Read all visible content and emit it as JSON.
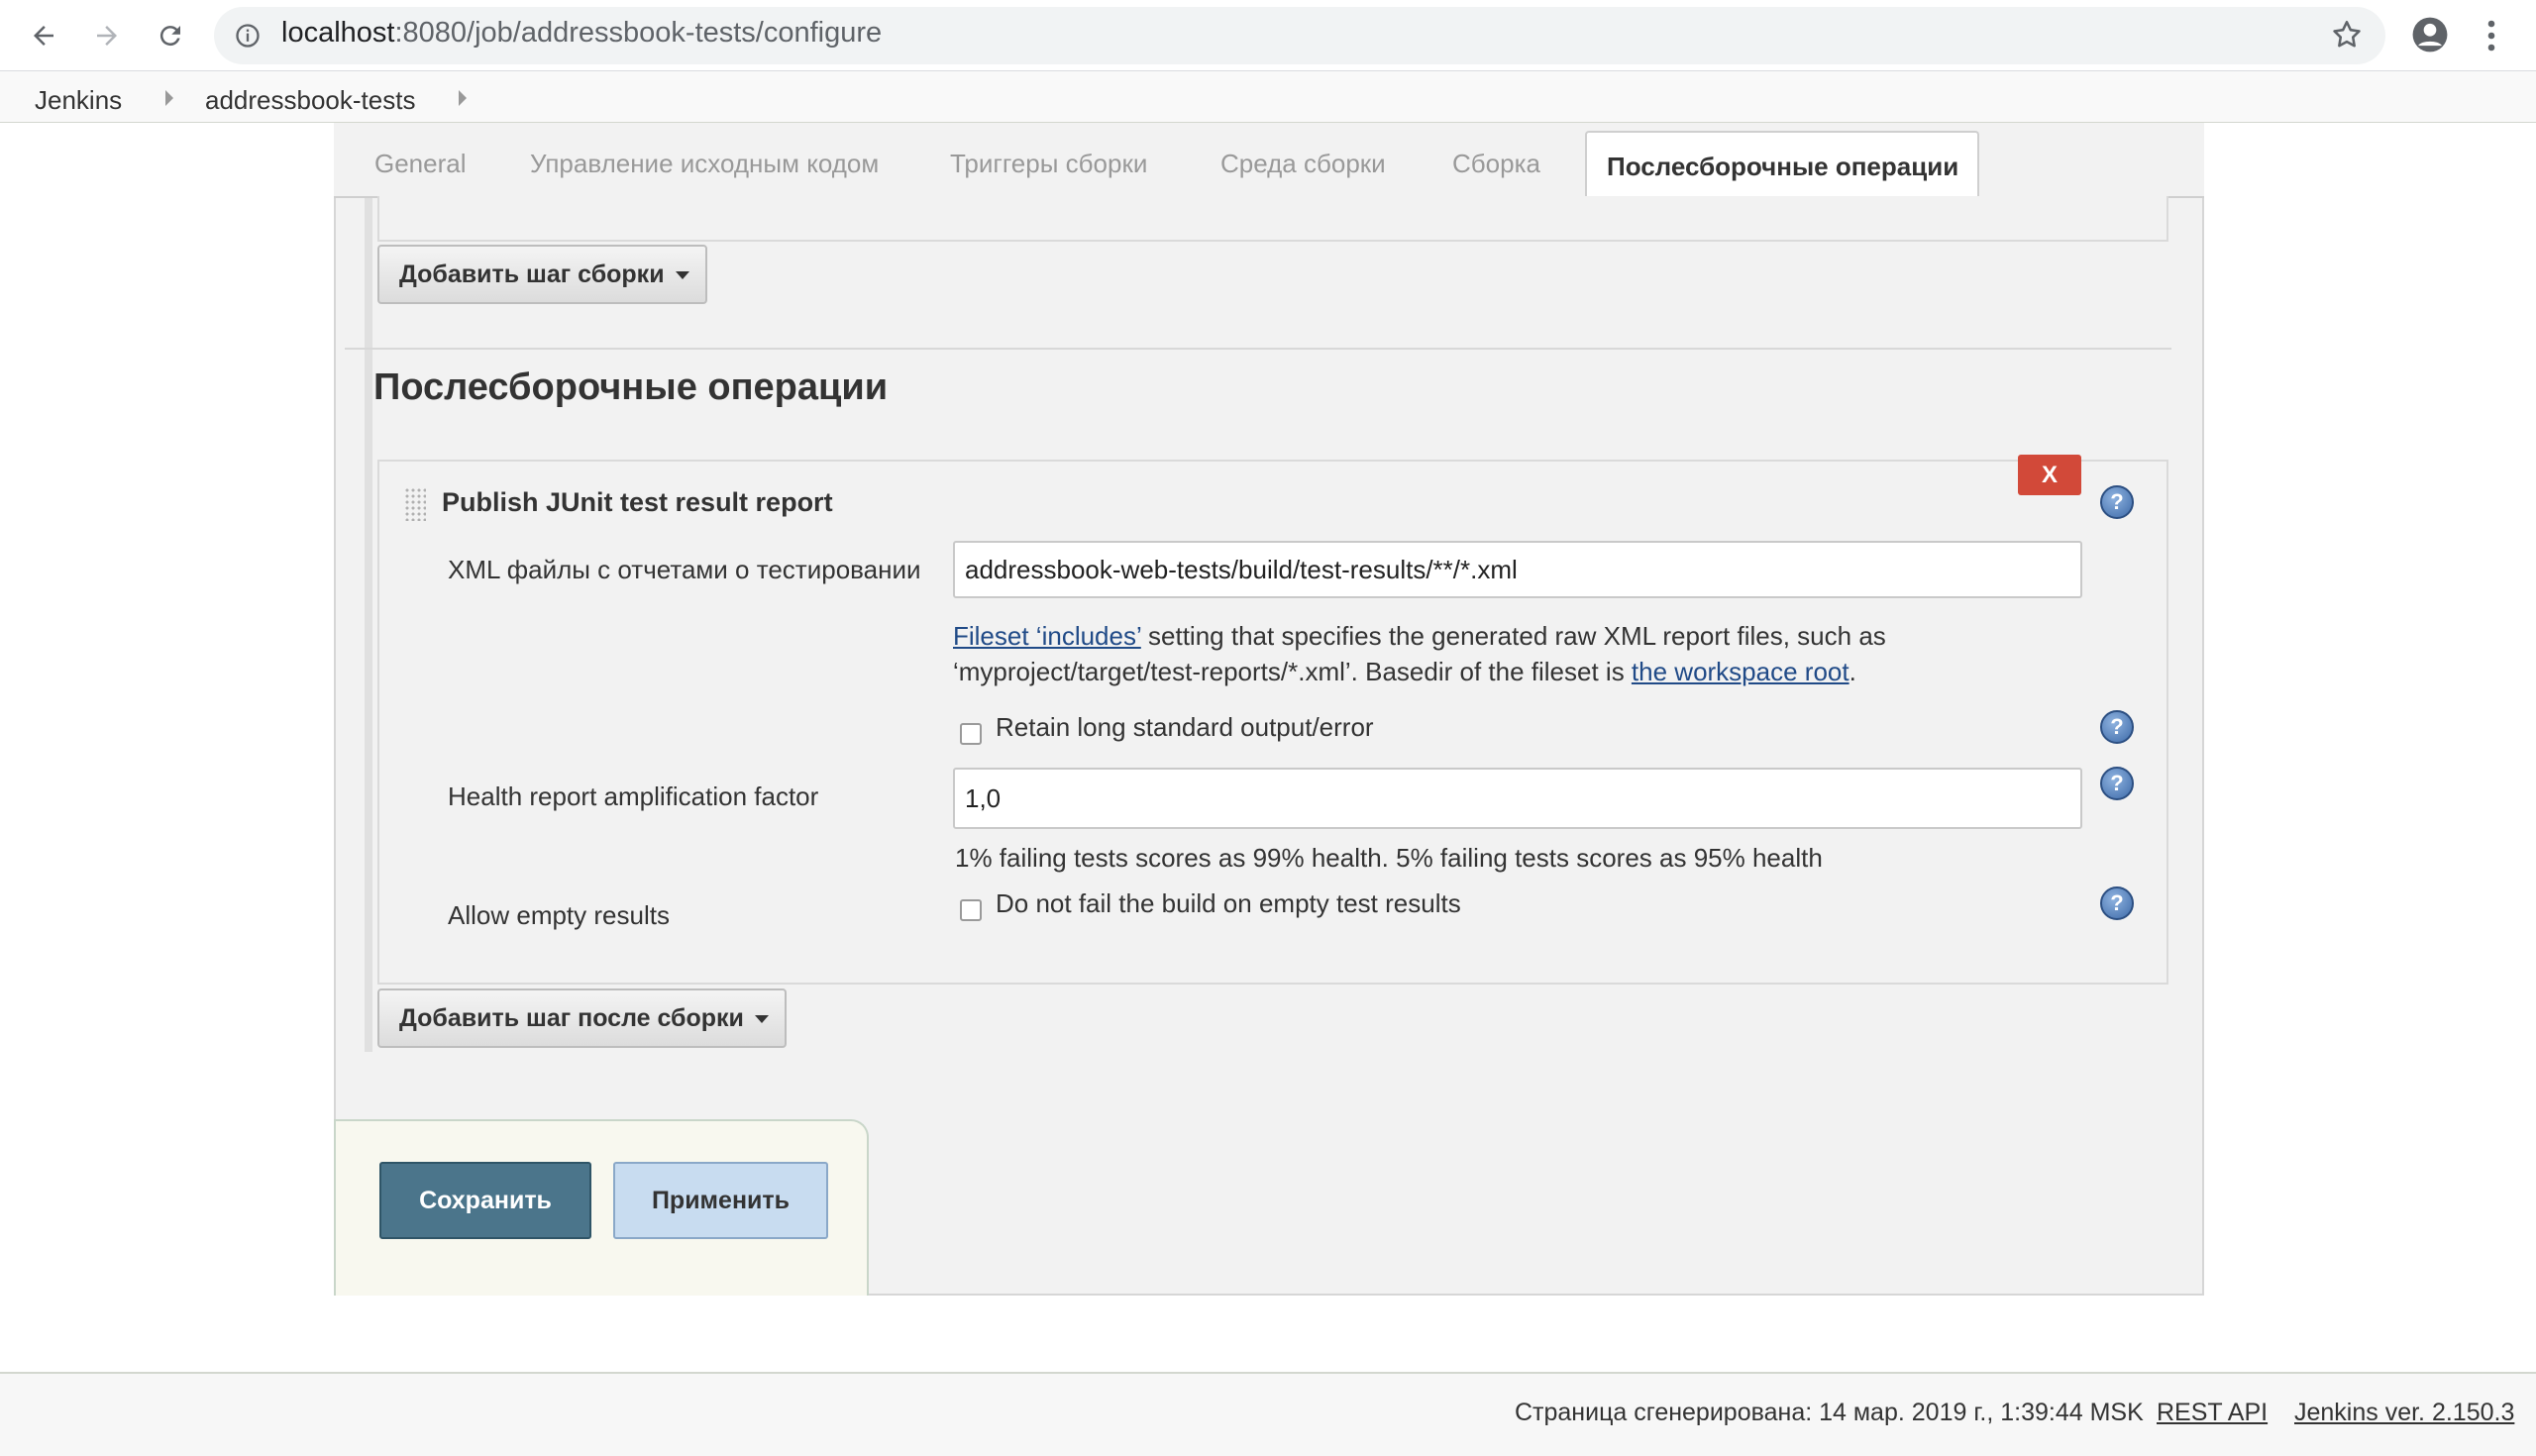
{
  "browser": {
    "url_host": "localhost",
    "url_path": ":8080/job/addressbook-tests/configure"
  },
  "breadcrumbs": {
    "items": [
      "Jenkins",
      "addressbook-tests"
    ]
  },
  "tabs": [
    {
      "label": "General"
    },
    {
      "label": "Управление исходным кодом"
    },
    {
      "label": "Триггеры сборки"
    },
    {
      "label": "Среда сборки"
    },
    {
      "label": "Сборка"
    },
    {
      "label": "Послесборочные операции"
    }
  ],
  "build": {
    "add_step_label": "Добавить шаг сборки"
  },
  "post_build": {
    "title": "Послесборочные операции",
    "junit": {
      "title": "Publish JUnit test result report",
      "delete_label": "X",
      "xml_label": "XML файлы с отчетами о тестировании",
      "xml_value": "addressbook-web-tests/build/test-results/**/*.xml",
      "fileset_link": "Fileset ‘includes’",
      "fileset_desc_1": " setting that specifies the generated raw XML report files, such as",
      "fileset_desc_2": "‘myproject/target/test-reports/*.xml’. Basedir of the fileset is ",
      "workspace_link": "the workspace root",
      "fileset_desc_end": ".",
      "retain_label": "Retain long standard output/error",
      "health_label": "Health report amplification factor",
      "health_value": "1,0",
      "health_desc": "1% failing tests scores as 99% health. 5% failing tests scores as 95% health",
      "allow_empty_label": "Allow empty results",
      "allow_empty_checkbox": "Do not fail the build on empty test results"
    },
    "add_step_label": "Добавить шаг после сборки"
  },
  "actions": {
    "save": "Сохранить",
    "apply": "Применить"
  },
  "footer": {
    "generated": "Страница сгенерирована: 14 мар. 2019 г., 1:39:44 MSK",
    "rest_api": "REST API",
    "version": "Jenkins ver. 2.150.3"
  }
}
